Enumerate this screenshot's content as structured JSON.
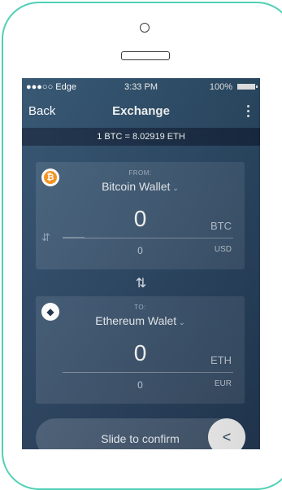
{
  "status_bar": {
    "carrier": "●●●○○ Edge",
    "time": "3:33 PM",
    "battery": "100%"
  },
  "nav": {
    "back_label": "Back",
    "title": "Exchange"
  },
  "rate": "1 BTC = 8.02919 ETH",
  "from": {
    "label": "FROM:",
    "wallet": "Bitcoin Wallet",
    "amount": "0",
    "currency": "BTC",
    "fiat_amount": "0",
    "fiat_currency": "USD",
    "coin_icon": "bitcoin-icon"
  },
  "to": {
    "label": "TO:",
    "wallet": "Ethereum Walet",
    "amount": "0",
    "currency": "ETH",
    "fiat_amount": "0",
    "fiat_currency": "EUR",
    "coin_icon": "ethereum-icon"
  },
  "slider": {
    "label": "Slide to confirm"
  },
  "colors": {
    "frame": "#4fd0b4",
    "screen": "#2d4a68",
    "btc": "#f7931a"
  }
}
